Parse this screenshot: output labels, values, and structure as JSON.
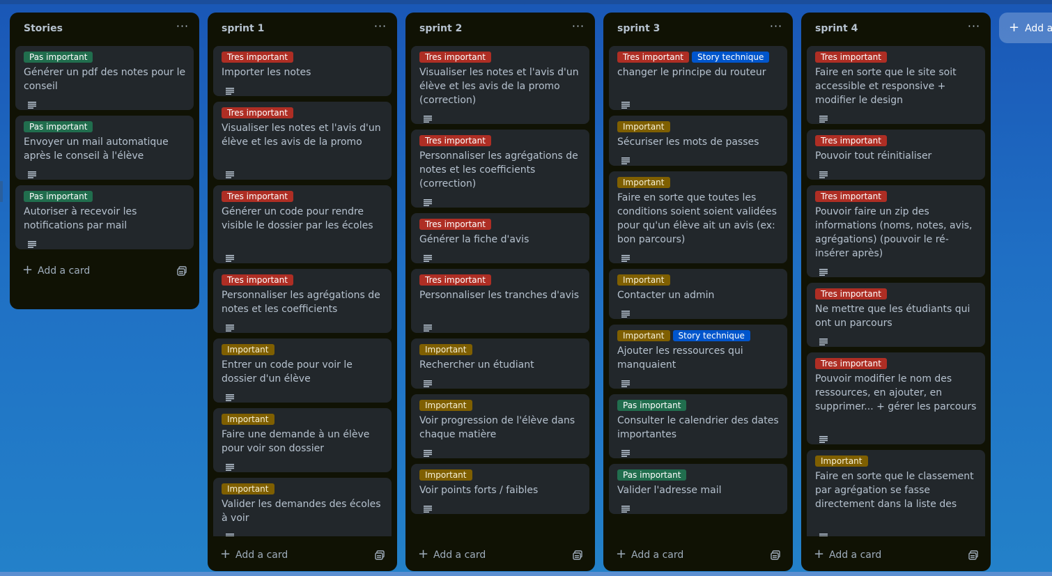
{
  "board": {
    "add_list_label": "Add another list"
  },
  "common": {
    "add_card_label": "Add a card",
    "list_menu_glyph": "···"
  },
  "colors": {
    "Tres important": "#ae2e24",
    "Important": "#7f5f01",
    "Pas important": "#216e4e",
    "Story technique": "#0055cc"
  },
  "lists": [
    {
      "title": "Stories",
      "cards": [
        {
          "labels": [
            "Pas important"
          ],
          "title": "Générer un pdf des notes pour le conseil"
        },
        {
          "labels": [
            "Pas important"
          ],
          "title": "Envoyer un mail automatique après le conseil à l'élève"
        },
        {
          "labels": [
            "Pas important"
          ],
          "title": "Autoriser à recevoir les notifications par mail"
        }
      ]
    },
    {
      "title": "sprint 1",
      "cards": [
        {
          "labels": [
            "Tres important"
          ],
          "title": "Importer les notes"
        },
        {
          "labels": [
            "Tres important"
          ],
          "title": "Visualiser les notes et l'avis d'un élève et les avis de la promo"
        },
        {
          "labels": [
            "Tres important"
          ],
          "title": "Générer un code pour rendre visible le dossier par les écoles"
        },
        {
          "labels": [
            "Tres important"
          ],
          "title": "Personnaliser les agrégations de notes et les coefficients"
        },
        {
          "labels": [
            "Important"
          ],
          "title": "Entrer un code pour voir le dossier d'un élève"
        },
        {
          "labels": [
            "Important"
          ],
          "title": "Faire une demande à un élève pour voir son dossier"
        },
        {
          "labels": [
            "Important"
          ],
          "title": "Valider les demandes des écoles à voir"
        }
      ]
    },
    {
      "title": "sprint 2",
      "cards": [
        {
          "labels": [
            "Tres important"
          ],
          "title": "Visualiser les notes et l'avis d'un élève et les avis de la promo (correction)"
        },
        {
          "labels": [
            "Tres important"
          ],
          "title": "Personnaliser les agrégations de notes et les coefficients (correction)"
        },
        {
          "labels": [
            "Tres important"
          ],
          "title": "Générer la fiche d'avis"
        },
        {
          "labels": [
            "Tres important"
          ],
          "title": "Personnaliser les tranches d'avis"
        },
        {
          "labels": [
            "Important"
          ],
          "title": "Rechercher un étudiant"
        },
        {
          "labels": [
            "Important"
          ],
          "title": "Voir progression de l'élève dans chaque matière"
        },
        {
          "labels": [
            "Important"
          ],
          "title": "Voir points forts / faibles"
        }
      ]
    },
    {
      "title": "sprint 3",
      "cards": [
        {
          "labels": [
            "Tres important",
            "Story technique"
          ],
          "title": "changer le principe du routeur"
        },
        {
          "labels": [
            "Important"
          ],
          "title": "Sécuriser les mots de passes"
        },
        {
          "labels": [
            "Important"
          ],
          "title": "Faire en sorte que toutes les conditions soient soient validées pour qu'un élève ait un avis (ex: bon parcours)"
        },
        {
          "labels": [
            "Important"
          ],
          "title": "Contacter un admin"
        },
        {
          "labels": [
            "Important",
            "Story technique"
          ],
          "title": "Ajouter les ressources qui manquaient"
        },
        {
          "labels": [
            "Pas important"
          ],
          "title": "Consulter le calendrier des dates importantes"
        },
        {
          "labels": [
            "Pas important"
          ],
          "title": "Valider l'adresse mail"
        }
      ]
    },
    {
      "title": "sprint 4",
      "cards": [
        {
          "labels": [
            "Tres important"
          ],
          "title": "Faire en sorte que le site soit accessible et responsive + modifier le design"
        },
        {
          "labels": [
            "Tres important"
          ],
          "title": "Pouvoir tout réinitialiser"
        },
        {
          "labels": [
            "Tres important"
          ],
          "title": "Pouvoir faire un zip des informations (noms, notes, avis, agrégations) (pouvoir le ré-insérer après)"
        },
        {
          "labels": [
            "Tres important"
          ],
          "title": "Ne mettre que les étudiants qui ont un parcours"
        },
        {
          "labels": [
            "Tres important"
          ],
          "title": "Pouvoir modifier le nom des ressources, en ajouter, en supprimer... + gérer les parcours"
        },
        {
          "labels": [
            "Important"
          ],
          "title": "Faire en sorte que le classement par agrégation se fasse directement dans la liste des"
        }
      ]
    }
  ]
}
